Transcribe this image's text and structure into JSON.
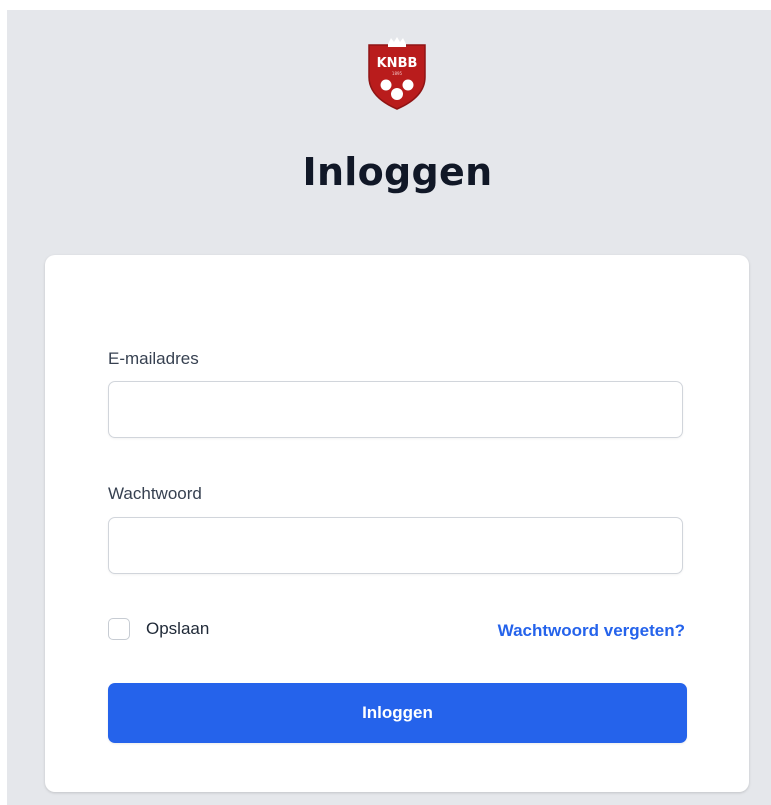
{
  "logo": {
    "icon": "knbb-logo-icon",
    "text": "KNBB",
    "colors": {
      "shield": "#b91c1c",
      "crown": "#ffffff",
      "balls": "#ffffff"
    }
  },
  "header": {
    "title": "Inloggen"
  },
  "form": {
    "email": {
      "label": "E-mailadres",
      "value": "",
      "placeholder": ""
    },
    "password": {
      "label": "Wachtwoord",
      "value": "",
      "placeholder": ""
    },
    "remember": {
      "label": "Opslaan",
      "checked": false
    },
    "forgot_link": "Wachtwoord vergeten?",
    "submit_label": "Inloggen"
  },
  "colors": {
    "background": "#e5e7eb",
    "card": "#ffffff",
    "accent": "#2563eb",
    "title": "#111827"
  }
}
